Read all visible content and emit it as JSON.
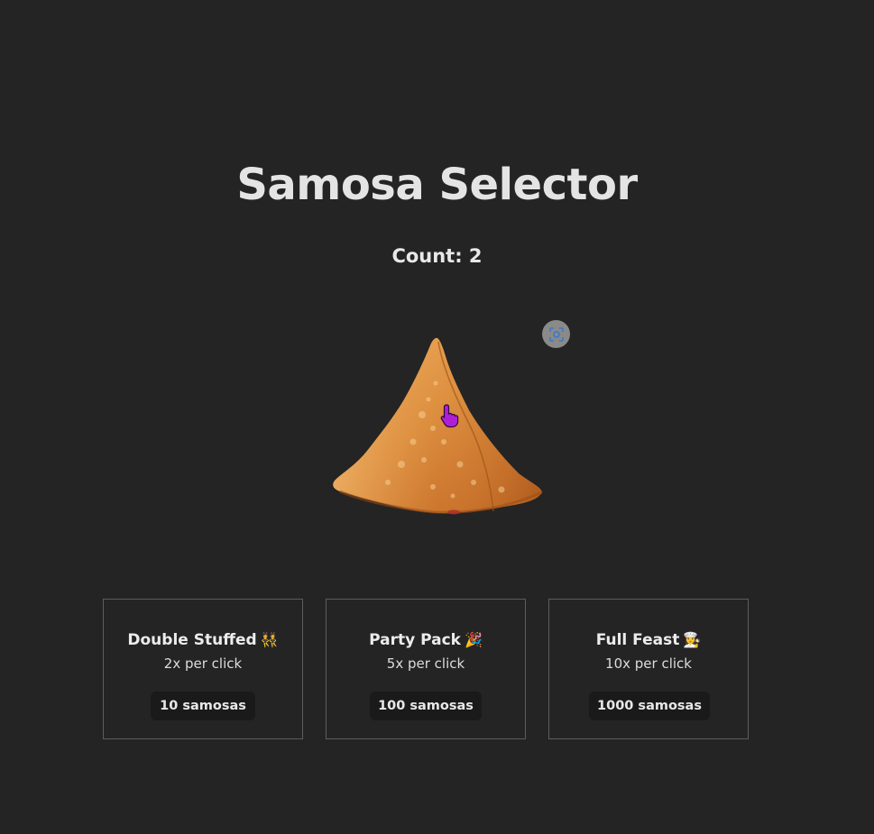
{
  "header": {
    "title": "Samosa Selector",
    "count_label": "Count: 2"
  },
  "samosa": {
    "image_name": "samosa-image"
  },
  "upgrades": [
    {
      "name": "Double Stuffed",
      "emoji": "👯",
      "rate": "2x per click",
      "cost": "10 samosas"
    },
    {
      "name": "Party Pack",
      "emoji": "🎉",
      "rate": "5x per click",
      "cost": "100 samosas"
    },
    {
      "name": "Full Feast",
      "emoji": "👩‍🍳",
      "rate": "10x per click",
      "cost": "1000 samosas"
    }
  ],
  "colors": {
    "background": "#242424",
    "text": "#e6e6e6",
    "card_border": "#5d5d5d",
    "button_bg": "#1a1a1a",
    "samosa_main": "#d98a3a",
    "cursor": "#b01fd8"
  }
}
